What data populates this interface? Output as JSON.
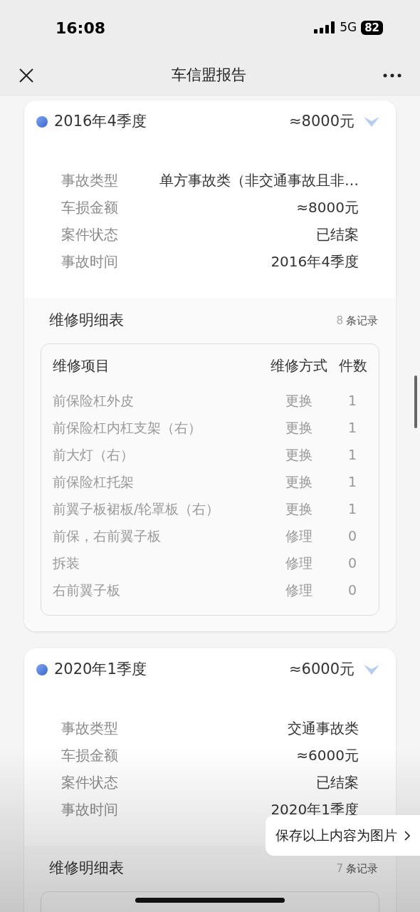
{
  "status_bar": {
    "time": "16:08",
    "network": "5G",
    "battery": "82"
  },
  "nav": {
    "title": "车信盟报告"
  },
  "records": [
    {
      "period": "2016年4季度",
      "amount": "≈8000元",
      "info": [
        {
          "label": "事故类型",
          "value": "单方事故类（非交通事故且非…"
        },
        {
          "label": "车损金额",
          "value": "≈8000元"
        },
        {
          "label": "案件状态",
          "value": "已结案"
        },
        {
          "label": "事故时间",
          "value": "2016年4季度"
        }
      ],
      "details": {
        "title": "维修明细表",
        "count": "8",
        "count_unit": "条记录",
        "columns": [
          "维修项目",
          "维修方式",
          "件数"
        ],
        "rows": [
          {
            "item": "前保险杠外皮",
            "method": "更换",
            "qty": "1"
          },
          {
            "item": "前保险杠内杠支架（右）",
            "method": "更换",
            "qty": "1"
          },
          {
            "item": "前大灯（右）",
            "method": "更换",
            "qty": "1"
          },
          {
            "item": "前保险杠托架",
            "method": "更换",
            "qty": "1"
          },
          {
            "item": "前翼子板裙板/轮罩板（右）",
            "method": "更换",
            "qty": "1"
          },
          {
            "item": "前保，右前翼子板",
            "method": "修理",
            "qty": "0"
          },
          {
            "item": "拆装",
            "method": "修理",
            "qty": "0"
          },
          {
            "item": "右前翼子板",
            "method": "修理",
            "qty": "0"
          }
        ]
      }
    },
    {
      "period": "2020年1季度",
      "amount": "≈6000元",
      "info": [
        {
          "label": "事故类型",
          "value": "交通事故类"
        },
        {
          "label": "车损金额",
          "value": "≈6000元"
        },
        {
          "label": "案件状态",
          "value": "已结案"
        },
        {
          "label": "事故时间",
          "value": "2020年1季度"
        }
      ],
      "details": {
        "title": "维修明细表",
        "count": "7",
        "count_unit": "条记录"
      }
    }
  ],
  "toast": {
    "text": "保存以上内容为图片"
  }
}
